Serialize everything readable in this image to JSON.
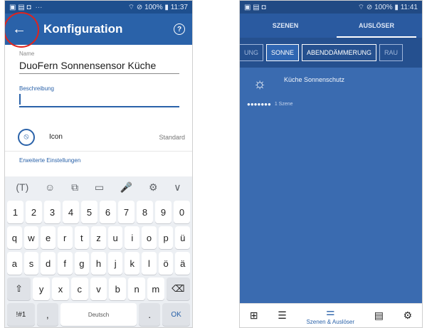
{
  "left": {
    "status": {
      "time": "11:37",
      "battery": "100%"
    },
    "appbar": {
      "back": "←",
      "title": "Konfiguration",
      "help": "?"
    },
    "name": {
      "label": "Name",
      "value": "DuoFern Sonnensensor Küche"
    },
    "beschreibung": {
      "label": "Beschreibung",
      "value": ""
    },
    "icon_row": {
      "label": "Icon",
      "value": "Standard"
    },
    "advanced_link": "Erweiterte Einstellungen",
    "keyboard": {
      "toolbar": [
        "(T)",
        "☺",
        "⧉",
        "▭",
        "🎤",
        "⚙",
        "∨"
      ],
      "row1": [
        "1",
        "2",
        "3",
        "4",
        "5",
        "6",
        "7",
        "8",
        "9",
        "0"
      ],
      "row2": [
        "q",
        "w",
        "e",
        "r",
        "t",
        "z",
        "u",
        "i",
        "o",
        "p",
        "ü"
      ],
      "row3": [
        "a",
        "s",
        "d",
        "f",
        "g",
        "h",
        "j",
        "k",
        "l",
        "ö",
        "ä"
      ],
      "row4": [
        "⇧",
        "y",
        "x",
        "c",
        "v",
        "b",
        "n",
        "m",
        "⌫"
      ],
      "row5": {
        "sym": "!#1",
        "comma": ",",
        "space": "Deutsch",
        "dot": ".",
        "ok": "OK"
      }
    }
  },
  "right": {
    "status": {
      "time": "11:41",
      "battery": "100%"
    },
    "tabs": [
      "SZENEN",
      "AUSLÖSER"
    ],
    "chips": [
      "UNG",
      "SONNE",
      "ABENDDÄMMERUNG",
      "RAU"
    ],
    "trigger": {
      "name": "Küche Sonnenschutz",
      "scenes": "1 Szene",
      "dots": "●●●●●●●"
    },
    "nav": {
      "active_label": "Szenen & Auslöser"
    }
  },
  "colors": {
    "primary": "#2a62a9",
    "highlight": "#e0231c"
  }
}
